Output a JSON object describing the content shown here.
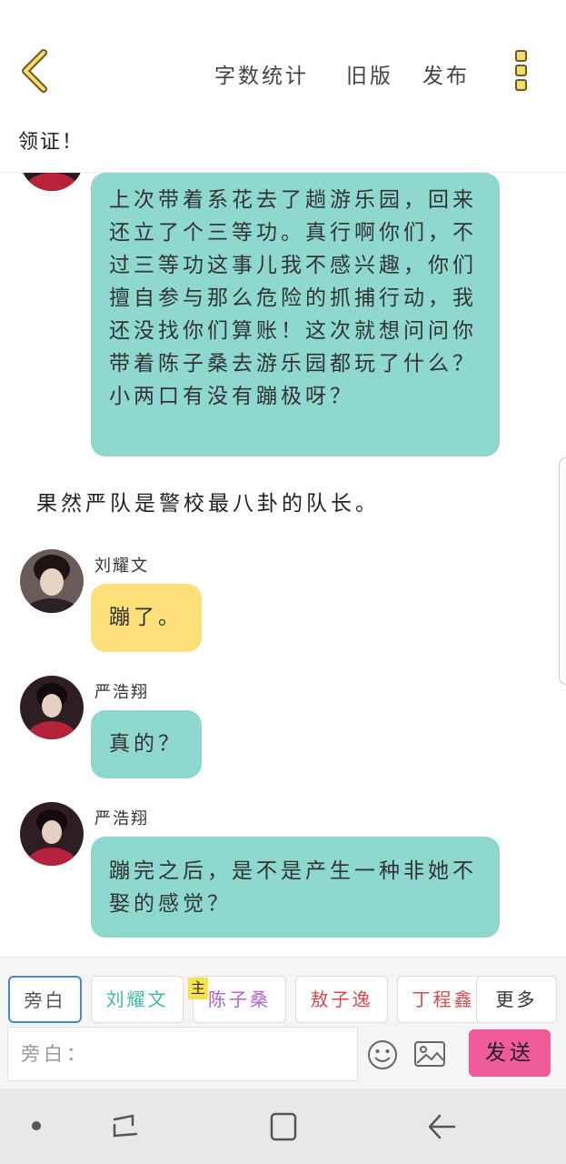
{
  "header": {
    "actions": [
      "字数统计",
      "旧版",
      "发布"
    ],
    "title": "领证！"
  },
  "messages": [
    {
      "type": "message",
      "color": "#8ed8d0",
      "text": "上次带着系花去了趟游乐园，回来还立了个三等功。真行啊你们，不过三等功这事儿我不感兴趣，你们擅自参与那么危险的抓捕行动，我还没找你们算账！这次就想问问你带着陈子桑去游乐园都玩了什么？小两口有没有蹦极呀？"
    },
    {
      "type": "narration",
      "text": "果然严队是警校最八卦的队长。"
    },
    {
      "type": "message",
      "sender": "刘耀文",
      "color": "#fde07a",
      "text": "蹦了。"
    },
    {
      "type": "message",
      "sender": "严浩翔",
      "color": "#8ed8d0",
      "text": "真的？"
    },
    {
      "type": "message",
      "sender": "严浩翔",
      "color": "#8ed8d0",
      "text": "蹦完之后，是不是产生一种非她不娶的感觉？"
    }
  ],
  "roles": [
    {
      "label": "旁白",
      "color": "#555555",
      "active": true
    },
    {
      "label": "刘耀文",
      "color": "#3fb8b0"
    },
    {
      "label": "陈子桑",
      "color": "#b55fd0",
      "tag": "主"
    },
    {
      "label": "敖子逸",
      "color": "#d84a4a"
    },
    {
      "label": "丁程鑫",
      "color": "#d84a4a"
    },
    {
      "label": "更多",
      "color": "#333333"
    }
  ],
  "composer": {
    "placeholder": "旁白：",
    "send_label": "发送"
  },
  "colors": {
    "teal_bubble": "#8ed8d0",
    "yellow_bubble": "#fde07a",
    "send_button": "#f05c9a",
    "main_tag": "#f7e24a"
  }
}
